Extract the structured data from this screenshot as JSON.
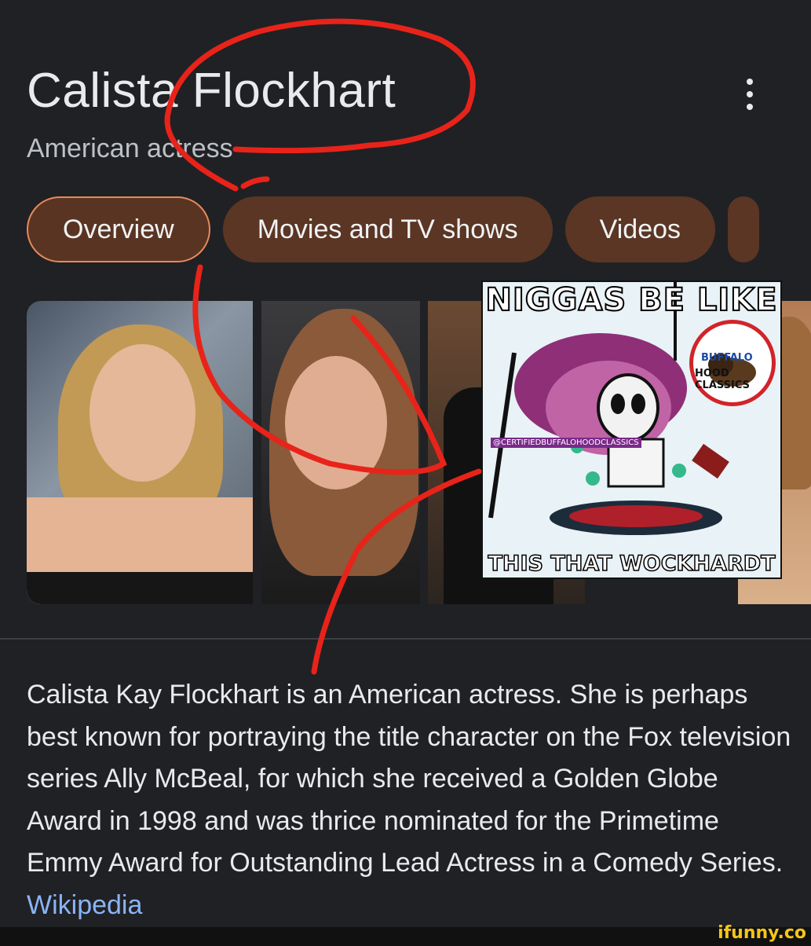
{
  "header": {
    "title": "Calista Flockhart",
    "subtitle": "American actress",
    "more_icon": "more-vert-icon"
  },
  "tabs": [
    {
      "label": "Overview",
      "active": true
    },
    {
      "label": "Movies and TV shows",
      "active": false
    },
    {
      "label": "Videos",
      "active": false
    }
  ],
  "meme": {
    "top_text": "NIGGAS BE LIKE",
    "bottom_text": "THIS THAT WOCKHARDT",
    "handle": "@CERTIFIEDBUFFALOHOODCLASSICS",
    "badge_top": "BUFFALO",
    "badge_bottom": "HOOD CLASSICS"
  },
  "description": {
    "text": "Calista Kay Flockhart is an American actress. She is perhaps best known for portraying the title character on the Fox television series Ally McBeal, for which she received a Golden Globe Award in 1998 and was thrice nominated for the Primetime Emmy Award for Outstanding Lead Actress in a Comedy Series.",
    "source_link": "Wikipedia"
  },
  "watermark": "ifunny.co",
  "colors": {
    "background": "#202124",
    "tab_fill": "#5b3624",
    "tab_active_border": "#e8895a",
    "link": "#8ab4f8",
    "annotation": "#e8231a"
  }
}
